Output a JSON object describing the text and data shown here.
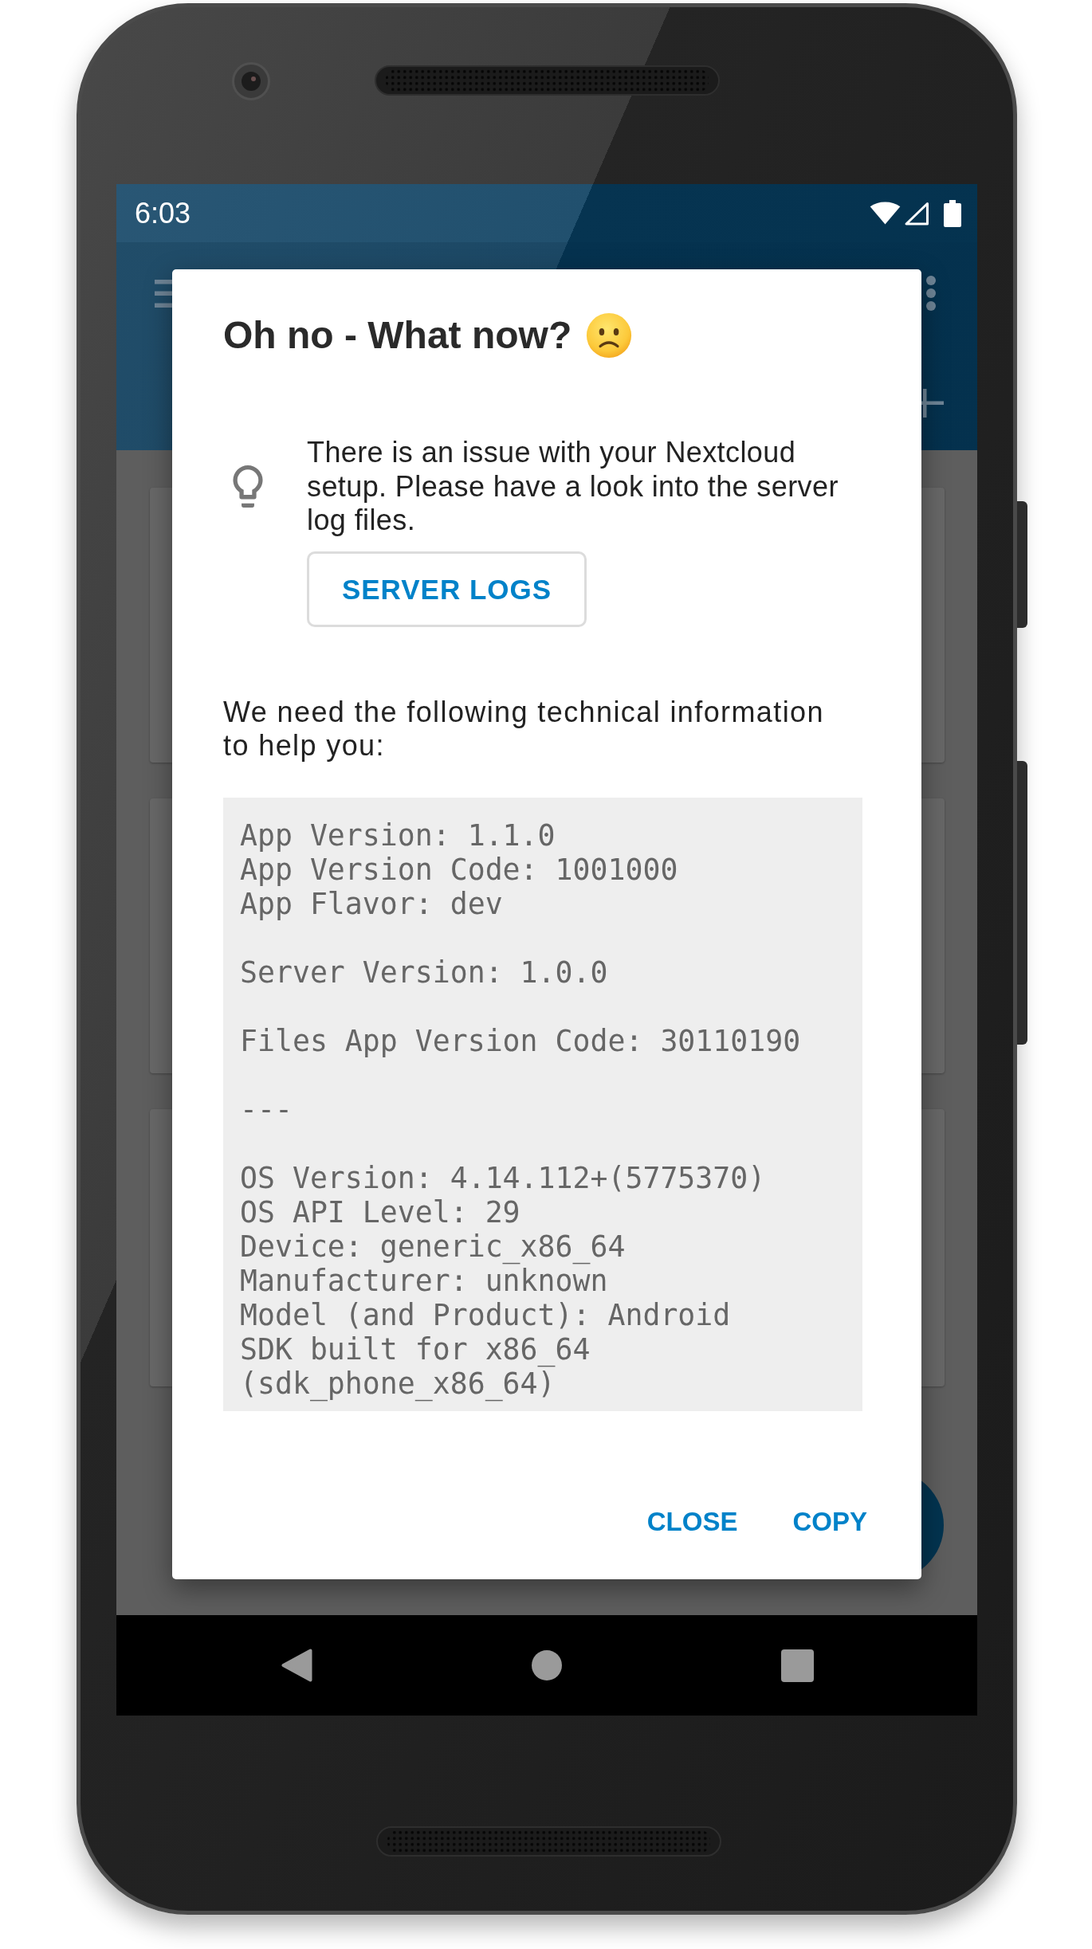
{
  "status_bar": {
    "time": "6:03"
  },
  "dialog": {
    "title": "Oh no - What now?",
    "hint": {
      "text": "There is an issue with your Nextcloud setup. Please have a look into the server log files.",
      "button": "SERVER LOGS"
    },
    "intro": "We need the following technical information to help you:",
    "technical_info": [
      [
        "App Version: 1.1.0",
        "App Version Code: 1001000",
        "App Flavor: dev"
      ],
      [
        "Server Version: 1.0.0"
      ],
      [
        "Files App Version Code: 30110190"
      ],
      [
        "---"
      ],
      [
        "OS Version: 4.14.112+(5775370)",
        "OS API Level: 29",
        "Device: generic_x86_64",
        "Manufacturer: unknown",
        "Model (and Product): Android",
        "SDK built for x86_64",
        "(sdk_phone_x86_64)"
      ]
    ],
    "buttons": [
      "CLOSE",
      "COPY"
    ]
  }
}
